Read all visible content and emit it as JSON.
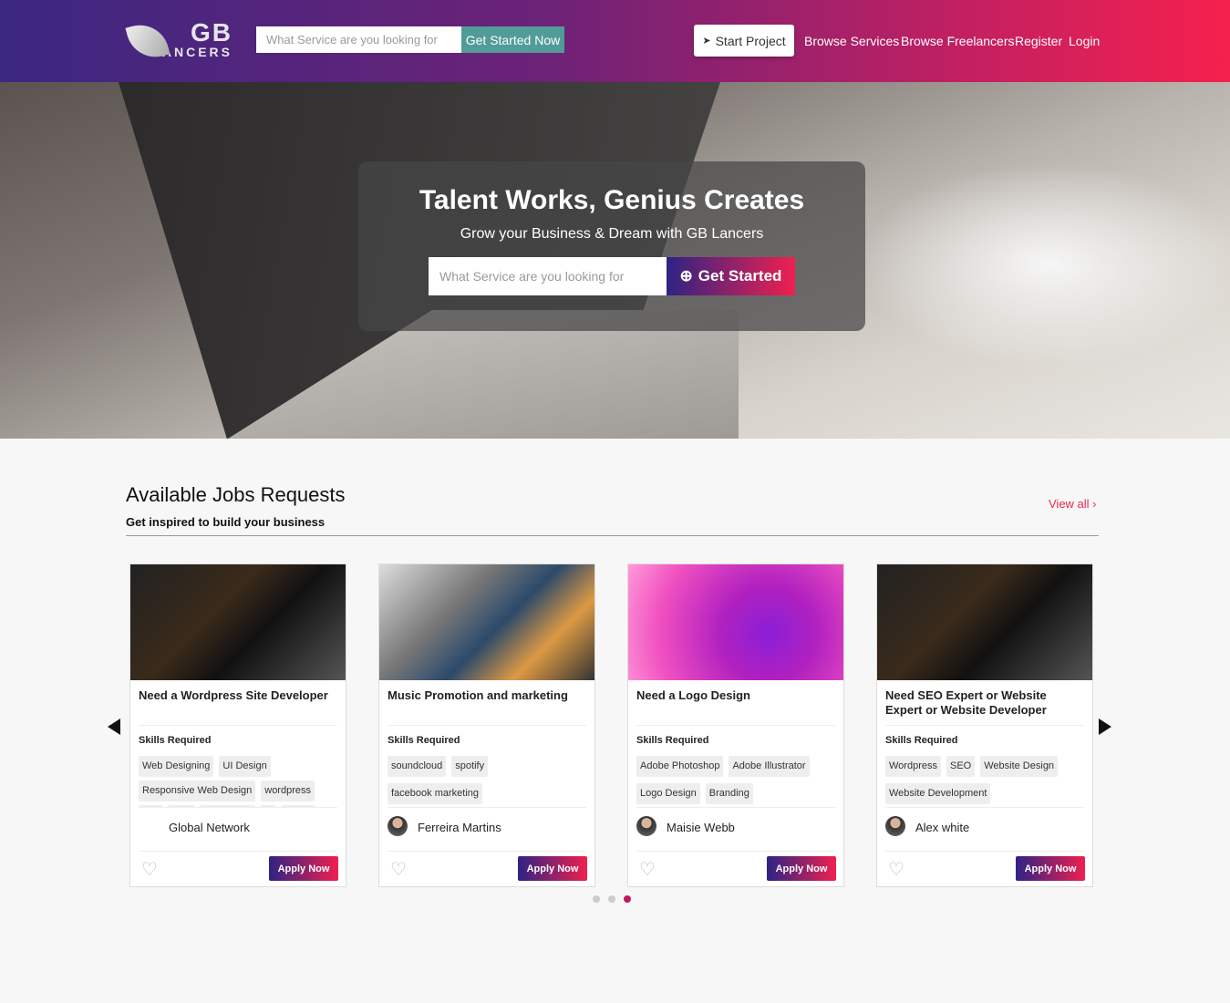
{
  "header": {
    "logo_top": "GB",
    "logo_bottom": "LANCERS",
    "search_placeholder": "What Service are you looking for",
    "search_button": "Get Started Now",
    "start_project": "Start Project",
    "nav": [
      "Browse Services",
      "Browse Freelancers",
      "Register",
      "Login"
    ]
  },
  "hero": {
    "title": "Talent Works, Genius Creates",
    "subtitle": "Grow your Business & Dream with GB Lancers",
    "search_placeholder": "What Service are you looking for",
    "button": "Get Started"
  },
  "jobs": {
    "title": "Available Jobs Requests",
    "subtitle": "Get inspired to build your business",
    "view_all": "View all ›",
    "skills_label": "Skills Required",
    "apply_label": "Apply Now",
    "cards": [
      {
        "title": "Need a Wordpress Site Developer",
        "skills": [
          "Web Designing",
          "UI Design",
          "Responsive Web Design",
          "wordpress",
          "php",
          "html",
          "css3 html5",
          "js",
          "jquery"
        ],
        "user": "Global Network"
      },
      {
        "title": "Music Promotion and marketing",
        "skills": [
          "soundcloud",
          "spotify",
          "facebook marketing"
        ],
        "user": "Ferreira Martins"
      },
      {
        "title": "Need a Logo Design",
        "skills": [
          "Adobe Photoshop",
          "Adobe Illustrator",
          "Logo Design",
          "Branding"
        ],
        "user": "Maisie Webb"
      },
      {
        "title": "Need SEO Expert or Website Expert or Website Developer",
        "skills": [
          "Wordpress",
          "SEO",
          "Website Design",
          "Website Development"
        ],
        "user": "Alex white"
      }
    ],
    "carousel": {
      "pages": 3,
      "active": 3
    }
  },
  "colors": {
    "accent": "#e8284c",
    "teal": "#519c98",
    "gradient_start": "#2e2384",
    "gradient_end": "#f0204f"
  }
}
